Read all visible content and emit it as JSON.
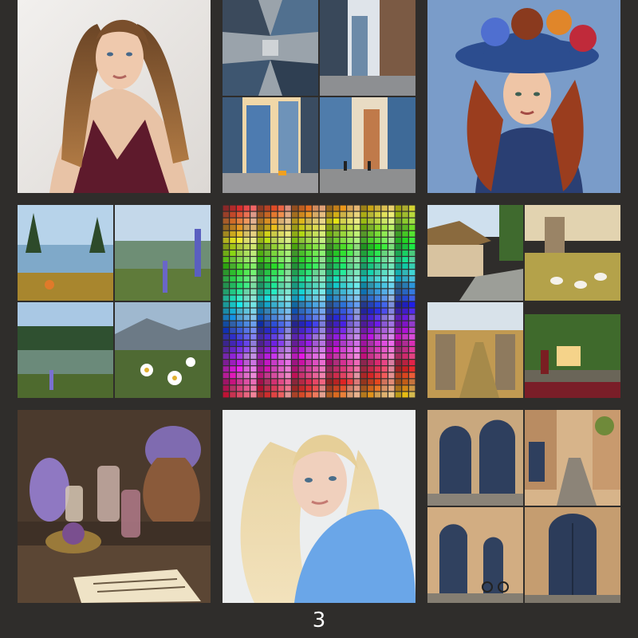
{
  "page": {
    "number": "3",
    "background": "#2f2d2b"
  },
  "tiles": [
    {
      "name": "portrait-woman-burgundy-dress"
    },
    {
      "name": "city-skyscrapers-collage"
    },
    {
      "name": "portrait-woman-flower-hat"
    },
    {
      "name": "mountain-lake-wildflowers-collage"
    },
    {
      "name": "color-swatch-palette-grid"
    },
    {
      "name": "english-village-collage"
    },
    {
      "name": "lavender-potion-still-life"
    },
    {
      "name": "portrait-blonde-woman-blue-top"
    },
    {
      "name": "old-town-blue-doors-collage"
    }
  ],
  "colors": {
    "burgundy": "#5e1a2c",
    "sky_blue": "#6aa6e8",
    "hat_blue": "#2c4d8f",
    "lavender": "#7f6bb0"
  }
}
